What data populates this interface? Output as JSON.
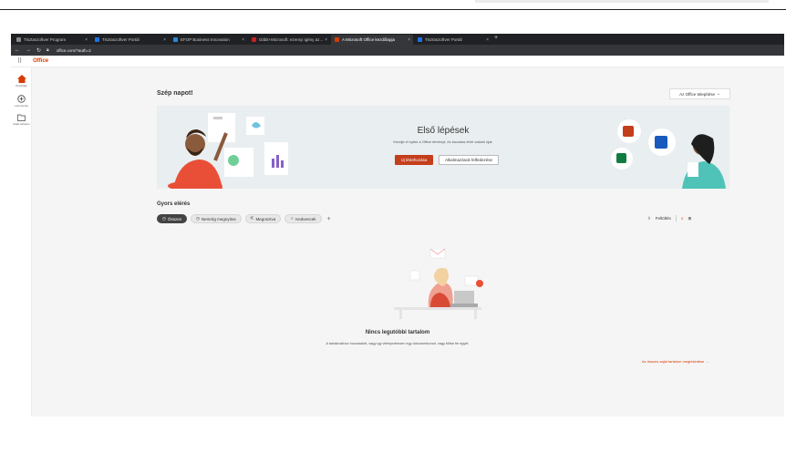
{
  "browser": {
    "tabs": [
      {
        "label": "Tisztaszoftver Program",
        "color": "#4a4a4a"
      },
      {
        "label": "Tisztaszoftver Portál",
        "color": "#1a73e8"
      },
      {
        "label": "EFOP Business Innovation",
        "color": "#2b88d8"
      },
      {
        "label": "Gitbit+Microsoft: ezernyi igény az...",
        "color": "#c5221f"
      },
      {
        "label": "A Microsoft Office kezdőlapja",
        "color": "#d83b01"
      },
      {
        "label": "Tisztaszoftver Portál",
        "color": "#1a73e8"
      }
    ],
    "new_tab": "+",
    "url": "office.com/?auth=2"
  },
  "appbar": {
    "brand": "Office"
  },
  "leftrail": [
    {
      "label": "Kezdőlap",
      "icon": "home-icon"
    },
    {
      "label": "Létrehozás",
      "icon": "create-icon"
    },
    {
      "label": "Saját tartalom",
      "icon": "folder-icon"
    }
  ],
  "main": {
    "greeting": "Szép napot!",
    "install_button": "Az Office telepítése",
    "banner": {
      "title": "Első lépések",
      "subtitle": "Kezdje el nyitni a Office élményt, és bocsáss létre valami újat.",
      "primary": "Új létrehozása",
      "secondary": "Alkalmazások felfedezése"
    },
    "quick_access": {
      "title": "Gyors elérés",
      "filters": [
        {
          "label": "Összes",
          "icon": "clock-icon",
          "active": true
        },
        {
          "label": "Nemrég megnyitva",
          "icon": "recent-icon",
          "active": false
        },
        {
          "label": "Megosztva",
          "icon": "share-icon",
          "active": false
        },
        {
          "label": "Kedvencek",
          "icon": "star-icon",
          "active": false
        }
      ],
      "add": "+",
      "upload": "Feltöltés"
    },
    "empty": {
      "title": "Nincs legutóbbi tartalom",
      "subtitle": "A tartalmakhoz hozzáadott, vagy így vélelyeztessen egy dokumentumot, vagy töltse fel egyet.",
      "link": "Az összes saját tartalom megtekintése"
    }
  },
  "colors": {
    "accent": "#d83b01",
    "primary_button": "#c43e1c",
    "banner_bg": "#e9eef0"
  }
}
